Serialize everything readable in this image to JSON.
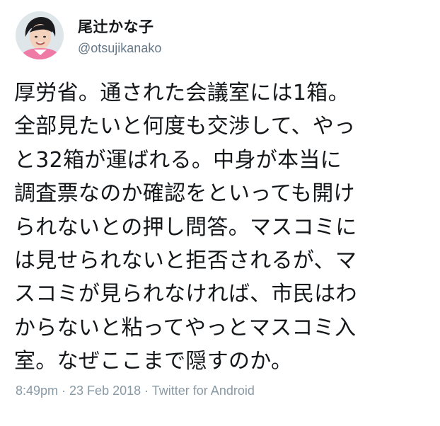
{
  "author": {
    "display_name": "尾辻かな子",
    "handle": "@otsujikanako",
    "avatar_icon": "profile-photo"
  },
  "tweet": {
    "lines": [
      "厚労省。通された会議室には1箱。",
      "全部見たいと何度も交渉して、やっ",
      "と32箱が運ばれる。中身が本当に",
      "調査票なのか確認をといっても開け",
      "られないとの押し問答。マスコミに",
      "は見せられないと拒否されるが、マ",
      "スコミが見られなければ、市民はわ",
      "からないと粘ってやっとマスコミ入",
      "室。なぜここまで隠すのか。"
    ]
  },
  "meta": {
    "timestamp": "8:49pm · 23 Feb 2018 · Twitter for Android"
  },
  "colors": {
    "text": "#14171a",
    "secondary": "#657786",
    "meta": "#8899a6"
  }
}
